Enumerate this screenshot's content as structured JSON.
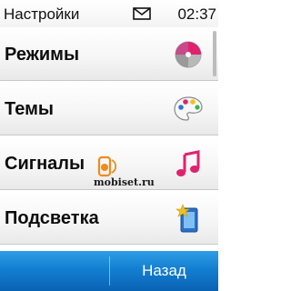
{
  "status_bar": {
    "title": "Настройки",
    "time": "02:37",
    "notification_icon": "mail-icon"
  },
  "menu": {
    "items": [
      {
        "label": "Режимы",
        "icon": "profiles-icon"
      },
      {
        "label": "Темы",
        "icon": "palette-icon"
      },
      {
        "label": "Сигналы",
        "icon": "music-note-icon"
      },
      {
        "label": "Подсветка",
        "icon": "display-light-icon"
      }
    ]
  },
  "watermark": {
    "text": "mobiset.ru"
  },
  "softkeys": {
    "back_label": "Назад"
  },
  "colors": {
    "softkey_bar": "#137fd1",
    "music_note": "#e0226e",
    "watermark_orange": "#f08a1c"
  }
}
